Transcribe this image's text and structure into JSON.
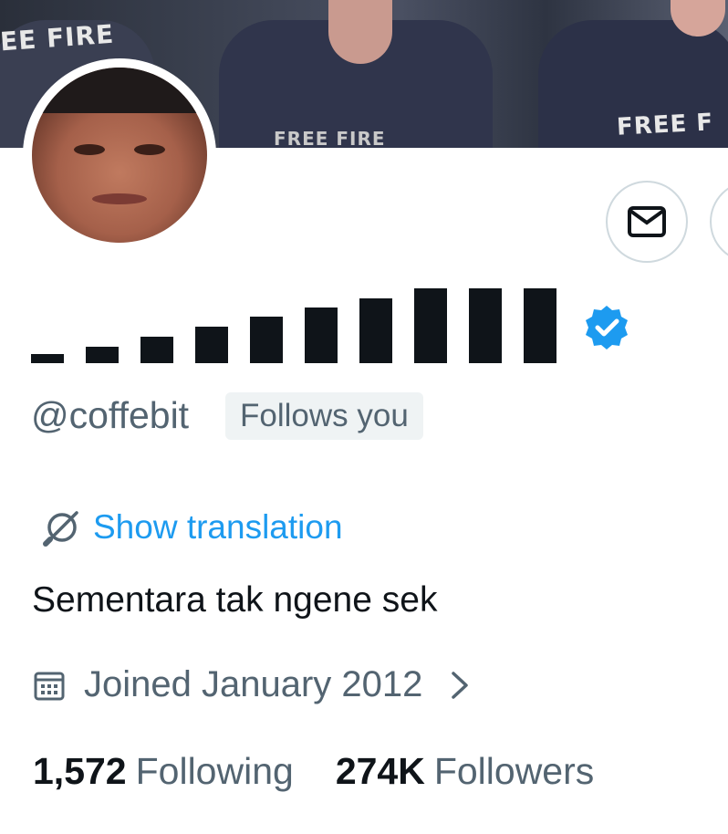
{
  "banner": {
    "print_left": "EE FIRE",
    "print_right": "FREE F",
    "print_mid": "FREE FIRE"
  },
  "profile": {
    "handle": "@coffebit",
    "follows_you_badge": "Follows you",
    "verified_color": "#1d9bf0",
    "display_name_icon": "signal-bars-name"
  },
  "translation": {
    "label": "Show translation",
    "icon": "globe-slash-icon"
  },
  "bio": "Sementara tak ngene sek",
  "joined": {
    "text": "Joined January 2012",
    "icon": "calendar-icon"
  },
  "stats": {
    "following_count": "1,572",
    "following_label": "Following",
    "followers_count": "274K",
    "followers_label": "Followers"
  },
  "colors": {
    "accent": "#1d9bf0",
    "text": "#0f1419",
    "muted": "#536471",
    "border": "#cfd9de"
  }
}
